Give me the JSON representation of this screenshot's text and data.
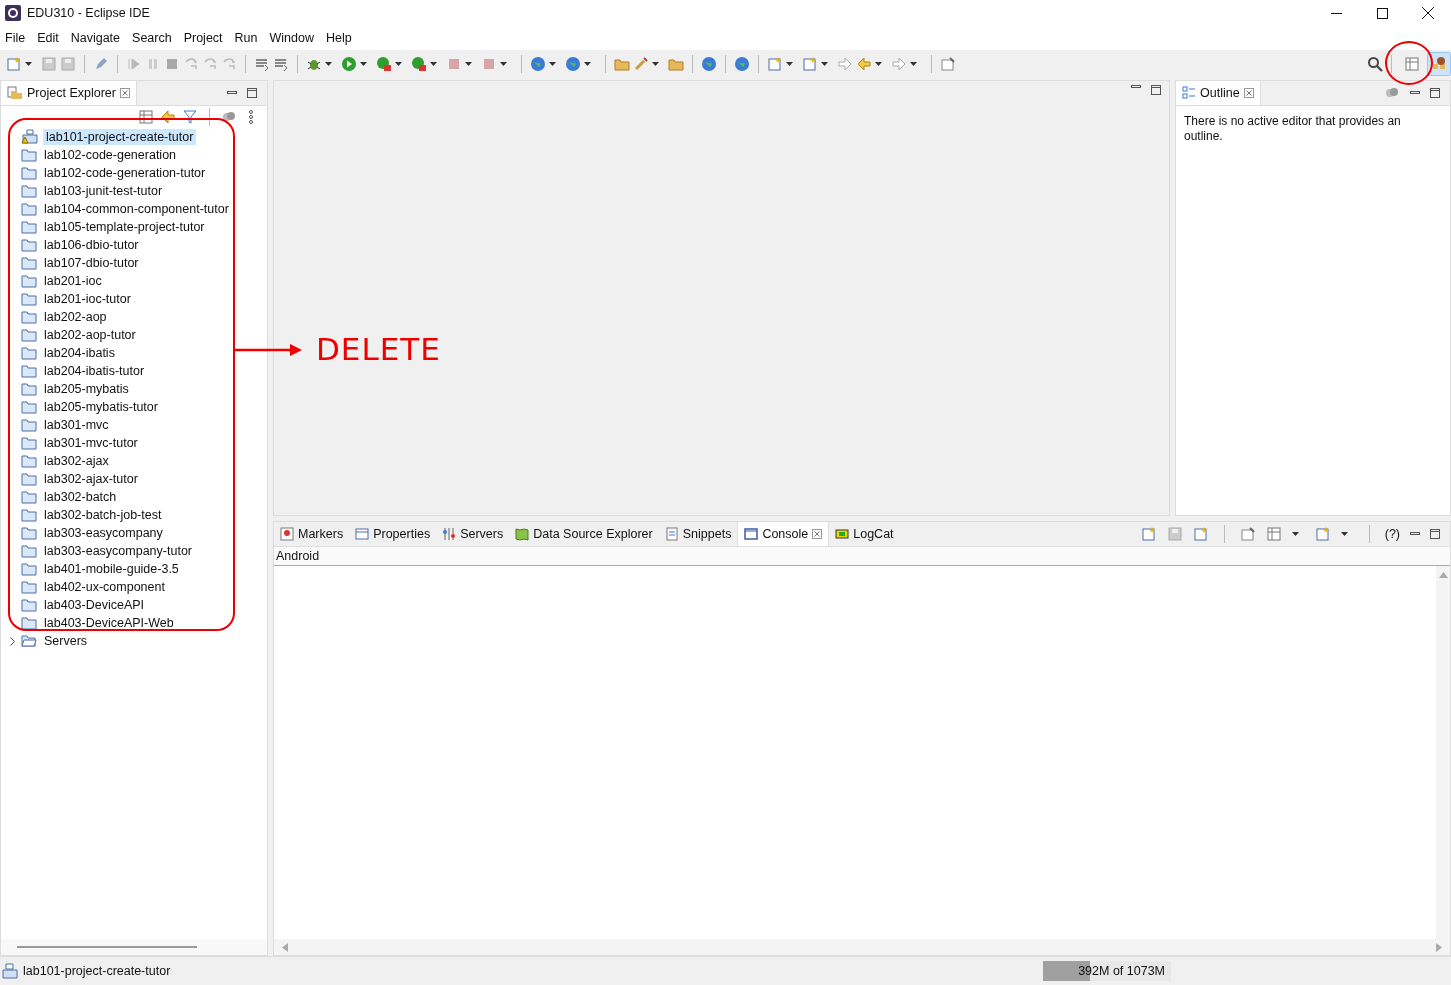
{
  "window": {
    "title": "EDU310 - Eclipse IDE"
  },
  "menu": [
    "File",
    "Edit",
    "Navigate",
    "Search",
    "Project",
    "Run",
    "Window",
    "Help"
  ],
  "perspective_buttons": [
    {
      "selected": false
    },
    {
      "selected": true
    }
  ],
  "project_explorer": {
    "title": "Project Explorer",
    "items": [
      {
        "name": "lab101-project-create-tutor",
        "kind": "warning-project",
        "selected": true
      },
      {
        "name": "lab102-code-generation",
        "kind": "project",
        "selected": false
      },
      {
        "name": "lab102-code-generation-tutor",
        "kind": "project",
        "selected": false
      },
      {
        "name": "lab103-junit-test-tutor",
        "kind": "project",
        "selected": false
      },
      {
        "name": "lab104-common-component-tutor",
        "kind": "project",
        "selected": false
      },
      {
        "name": "lab105-template-project-tutor",
        "kind": "project",
        "selected": false
      },
      {
        "name": "lab106-dbio-tutor",
        "kind": "project",
        "selected": false
      },
      {
        "name": "lab107-dbio-tutor",
        "kind": "project",
        "selected": false
      },
      {
        "name": "lab201-ioc",
        "kind": "project",
        "selected": false
      },
      {
        "name": "lab201-ioc-tutor",
        "kind": "project",
        "selected": false
      },
      {
        "name": "lab202-aop",
        "kind": "project",
        "selected": false
      },
      {
        "name": "lab202-aop-tutor",
        "kind": "project",
        "selected": false
      },
      {
        "name": "lab204-ibatis",
        "kind": "project",
        "selected": false
      },
      {
        "name": "lab204-ibatis-tutor",
        "kind": "project",
        "selected": false
      },
      {
        "name": "lab205-mybatis",
        "kind": "project",
        "selected": false
      },
      {
        "name": "lab205-mybatis-tutor",
        "kind": "project",
        "selected": false
      },
      {
        "name": "lab301-mvc",
        "kind": "project",
        "selected": false
      },
      {
        "name": "lab301-mvc-tutor",
        "kind": "project",
        "selected": false
      },
      {
        "name": "lab302-ajax",
        "kind": "project",
        "selected": false
      },
      {
        "name": "lab302-ajax-tutor",
        "kind": "project",
        "selected": false
      },
      {
        "name": "lab302-batch",
        "kind": "project",
        "selected": false
      },
      {
        "name": "lab302-batch-job-test",
        "kind": "project",
        "selected": false
      },
      {
        "name": "lab303-easycompany",
        "kind": "project",
        "selected": false
      },
      {
        "name": "lab303-easycompany-tutor",
        "kind": "project",
        "selected": false
      },
      {
        "name": "lab401-mobile-guide-3.5",
        "kind": "project",
        "selected": false
      },
      {
        "name": "lab402-ux-component",
        "kind": "project",
        "selected": false
      },
      {
        "name": "lab403-DeviceAPI",
        "kind": "project",
        "selected": false
      },
      {
        "name": "lab403-DeviceAPI-Web",
        "kind": "project",
        "selected": false
      },
      {
        "name": "Servers",
        "kind": "folder",
        "selected": false,
        "expanded": false
      }
    ]
  },
  "outline": {
    "title": "Outline",
    "message": "There is no active editor that provides an outline."
  },
  "bottom_tabs": [
    {
      "label": "Markers",
      "selected": false
    },
    {
      "label": "Properties",
      "selected": false
    },
    {
      "label": "Servers",
      "selected": false
    },
    {
      "label": "Data Source Explorer",
      "selected": false
    },
    {
      "label": "Snippets",
      "selected": false
    },
    {
      "label": "Console",
      "selected": true
    },
    {
      "label": "LogCat",
      "selected": false
    }
  ],
  "bottom_help": "(?)",
  "console": {
    "title": "Android"
  },
  "status_bar": {
    "selection": "lab101-project-create-tutor",
    "heap": {
      "reading": "392M of 1073M",
      "level": 0.365
    }
  },
  "annotation": {
    "label": "DELETE"
  }
}
